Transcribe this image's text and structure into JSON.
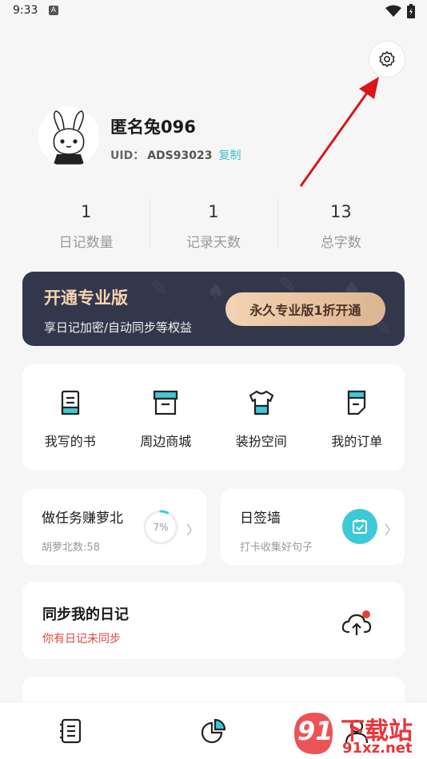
{
  "status_bar": {
    "time": "9:33",
    "notif_badge": "A"
  },
  "profile": {
    "username": "匿名兔096",
    "uid_label": "UID：",
    "uid_value": "ADS93023",
    "copy_label": "复制"
  },
  "stats": [
    {
      "value": "1",
      "label": "日记数量"
    },
    {
      "value": "1",
      "label": "记录天数"
    },
    {
      "value": "13",
      "label": "总字数"
    }
  ],
  "pro_banner": {
    "title": "开通专业版",
    "subtitle": "享日记加密/自动同步等权益",
    "button": "永久专业版1折开通"
  },
  "shortcuts": [
    {
      "label": "我写的书",
      "icon": "book-icon"
    },
    {
      "label": "周边商城",
      "icon": "shop-icon"
    },
    {
      "label": "装扮空间",
      "icon": "shirt-icon"
    },
    {
      "label": "我的订单",
      "icon": "order-icon"
    }
  ],
  "task_card": {
    "title": "做任务赚萝北",
    "subtitle": "胡萝北数:58",
    "progress_text": "7%",
    "progress": 0.07
  },
  "checkin_card": {
    "title": "日签墙",
    "subtitle": "打卡收集好句子"
  },
  "sync_card": {
    "title": "同步我的日记",
    "subtitle": "你有日记未同步"
  },
  "watermark": {
    "text_top": "下载站",
    "text_bottom": "91xz.net",
    "logo_digits": "91"
  },
  "colors": {
    "accent": "#3dbdcb",
    "banner_bg": "#33374b",
    "gold": "#f4d4b0",
    "alert": "#e0453c",
    "arrow": "#d9141b"
  }
}
